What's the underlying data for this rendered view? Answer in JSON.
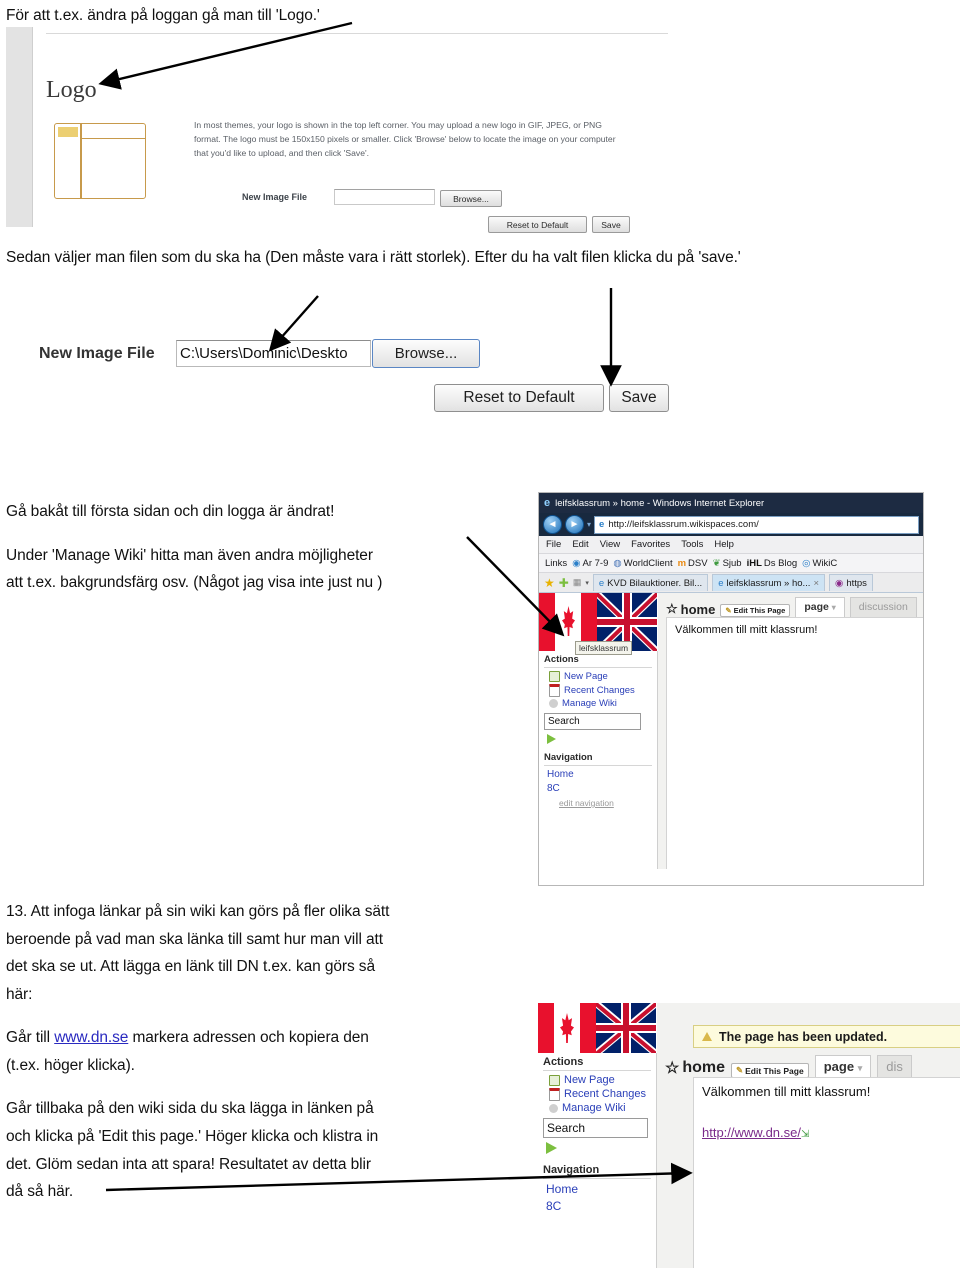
{
  "doc": {
    "heading1": "För att t.ex. ändra på loggan gå man till 'Logo.'",
    "heading2": "Sedan väljer man filen som du ska ha (Den måste vara i rätt storlek). Efter du ha valt filen klicka du på 'save.'",
    "para3_line1": "Gå bakåt till första sidan och din logga är ändrat!",
    "para3_line2": "Under 'Manage Wiki' hitta  man även andra möjligheter",
    "para3_line3": "att t.ex. bakgrundsfärg osv. (Något jag visa inte just nu )",
    "para13_line1": "13. Att infoga länkar på sin wiki kan görs på fler olika sätt",
    "para13_line2": "beroende på vad man ska länka till samt hur man vill att",
    "para13_line3": "det ska se ut. Att lägga en länk till DN t.ex. kan görs så",
    "para13_line4": "här:",
    "para13_line5a": "Går till ",
    "para13_link": "www.dn.se",
    "para13_line5b": " markera adressen och kopiera den",
    "para13_line6": "(t.ex. höger klicka).",
    "para13_line7": "Går tillbaka på den wiki sida du ska lägga in länken på",
    "para13_line8": "och klicka på 'Edit this page.' Höger klicka och klistra in",
    "para13_line9": "det. Glöm sedan inta att spara! Resultatet av detta blir",
    "para13_line10": "då så här."
  },
  "logo_panel": {
    "title": "Logo",
    "blurb_l1": "In most themes, your logo is shown in the top left corner. You may upload a new logo in GIF, JPEG, or PNG",
    "blurb_l2": "format. The logo must be 150x150 pixels or smaller. Click 'Browse' below to locate the image on your computer",
    "blurb_l3": "that you'd like to upload, and then click 'Save'.",
    "field_label": "New Image File",
    "field_value": "",
    "browse_label": "Browse...",
    "reset_label": "Reset to Default",
    "save_label": "Save"
  },
  "file_panel": {
    "field_label": "New Image File",
    "field_value": "C:\\Users\\Dominic\\Deskto",
    "browse_label": "Browse...",
    "reset_label": "Reset to Default",
    "save_label": "Save"
  },
  "browser": {
    "window_title": "leifsklassrum » home - Windows Internet Explorer",
    "address": "http://leifsklassrum.wikispaces.com/",
    "menus": [
      "File",
      "Edit",
      "View",
      "Favorites",
      "Tools",
      "Help"
    ],
    "links_label": "Links",
    "links": [
      "Ar 7-9",
      "WorldClient",
      "DSV",
      "Sjub",
      "Ds Blog",
      "WikiC"
    ],
    "links_ihl_prefix": "iHL",
    "tabs": [
      {
        "label": "KVD Bilauktioner. Bil...",
        "active": false
      },
      {
        "label": "leifsklassrum » ho...",
        "active": true
      },
      {
        "label": "https",
        "active": false
      }
    ],
    "tab_close": "×",
    "back_glyph": "◄",
    "forward_glyph": "►",
    "dropdown_glyph": "▾"
  },
  "wiki": {
    "tooltip": "leifsklassrum",
    "actions_heading": "Actions",
    "actions": [
      "New Page",
      "Recent Changes",
      "Manage Wiki"
    ],
    "search_value": "Search",
    "navigation_heading": "Navigation",
    "nav_items": [
      "Home",
      "8C"
    ],
    "edit_navigation": "edit navigation",
    "page_title": "home",
    "edit_button": "Edit This Page",
    "tab_page": "page",
    "tab_discussion": "discussion",
    "content": "Välkommen till mitt klassrum!",
    "star_glyph": "☆",
    "pencil_glyph": "✎",
    "caret_glyph": "▾"
  },
  "wiki2": {
    "notice": "The page has been updated.",
    "actions_heading": "Actions",
    "actions": [
      "New Page",
      "Recent Changes",
      "Manage Wiki"
    ],
    "search_value": "Search",
    "navigation_heading": "Navigation",
    "nav_items": [
      "Home",
      "8C"
    ],
    "page_title": "home",
    "edit_button": "Edit This Page",
    "tab_page": "page",
    "tab_discussion": "dis",
    "content": "Välkommen till mitt klassrum!",
    "dn_link": "http://www.dn.se/",
    "star_glyph": "☆",
    "pencil_glyph": "✎",
    "caret_glyph": "▾",
    "external_glyph": "⇲"
  },
  "colors": {
    "accent_brown": "#c79a4b",
    "link_blue": "#2a3fb8",
    "notice_bg": "#fdfbdd",
    "titlebar": "#1d2b42"
  }
}
